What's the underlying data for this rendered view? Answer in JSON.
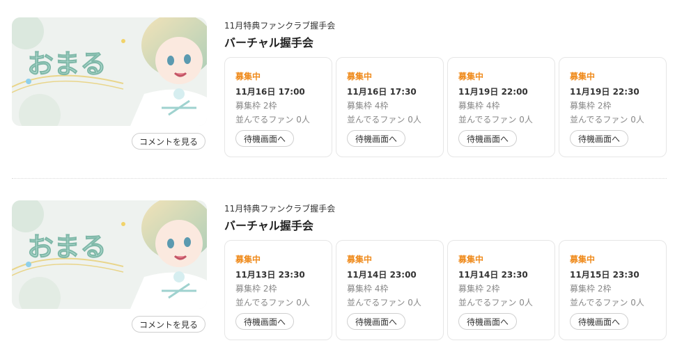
{
  "events": [
    {
      "subtitle": "11月特典ファンクラブ握手会",
      "title": "バーチャル握手会",
      "thumbnail_logo": "おまる",
      "comment_button": "コメントを見る",
      "slots": [
        {
          "status": "募集中",
          "datetime": "11月16日 17:00",
          "capacity": "募集枠 2枠",
          "queue": "並んでるファン 0人",
          "button": "待機画面へ"
        },
        {
          "status": "募集中",
          "datetime": "11月16日 17:30",
          "capacity": "募集枠 4枠",
          "queue": "並んでるファン 0人",
          "button": "待機画面へ"
        },
        {
          "status": "募集中",
          "datetime": "11月19日 22:00",
          "capacity": "募集枠 4枠",
          "queue": "並んでるファン 0人",
          "button": "待機画面へ"
        },
        {
          "status": "募集中",
          "datetime": "11月19日 22:30",
          "capacity": "募集枠 2枠",
          "queue": "並んでるファン 0人",
          "button": "待機画面へ"
        }
      ]
    },
    {
      "subtitle": "11月特典ファンクラブ握手会",
      "title": "バーチャル握手会",
      "thumbnail_logo": "おまる",
      "comment_button": "コメントを見る",
      "slots": [
        {
          "status": "募集中",
          "datetime": "11月13日 23:30",
          "capacity": "募集枠 2枠",
          "queue": "並んでるファン 0人",
          "button": "待機画面へ"
        },
        {
          "status": "募集中",
          "datetime": "11月14日 23:00",
          "capacity": "募集枠 4枠",
          "queue": "並んでるファン 0人",
          "button": "待機画面へ"
        },
        {
          "status": "募集中",
          "datetime": "11月14日 23:30",
          "capacity": "募集枠 2枠",
          "queue": "並んでるファン 0人",
          "button": "待機画面へ"
        },
        {
          "status": "募集中",
          "datetime": "11月15日 23:30",
          "capacity": "募集枠 2枠",
          "queue": "並んでるファン 0人",
          "button": "待機画面へ"
        }
      ]
    }
  ],
  "colors": {
    "status": "#ef8a1b",
    "border": "#e6e6e6",
    "text": "#222222",
    "muted": "#888888"
  }
}
